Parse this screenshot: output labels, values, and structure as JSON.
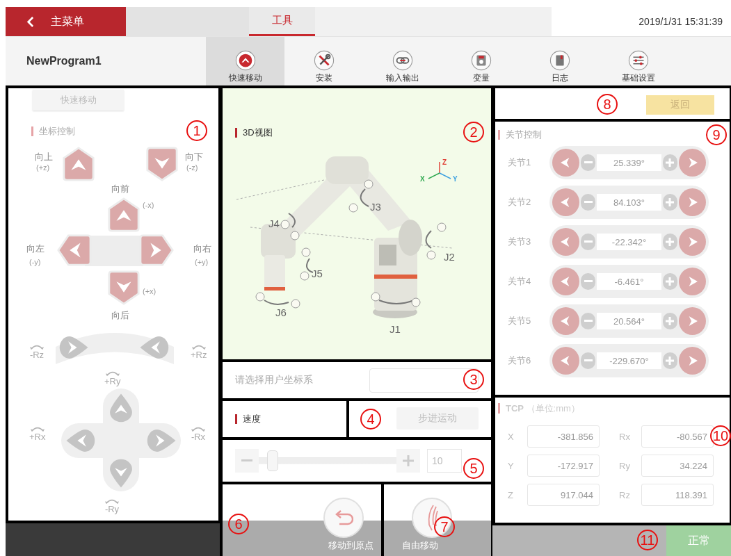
{
  "header": {
    "back_label": "主菜单",
    "tabs": [
      {
        "label": "工具",
        "selected": true
      }
    ],
    "datetime": "2019/1/31 15:31:39"
  },
  "program_name": "NewProgram1",
  "toolbar": [
    {
      "label": "快速移动",
      "kind": "jog",
      "selected": true
    },
    {
      "label": "安装",
      "kind": "tools",
      "selected": false
    },
    {
      "label": "输入输出",
      "kind": "io",
      "selected": false
    },
    {
      "label": "变量",
      "kind": "variable",
      "selected": false
    },
    {
      "label": "日志",
      "kind": "log",
      "selected": false
    },
    {
      "label": "基础设置",
      "kind": "settings",
      "selected": false
    }
  ],
  "coordinate_panel": {
    "marker": "1",
    "mode_button": "快速移动",
    "title": "坐标控制",
    "translation_pad": {
      "up_z": {
        "label": "向上",
        "axis": "(+z)"
      },
      "down_z": {
        "label": "向下",
        "axis": "(-z)"
      },
      "forward": {
        "label": "向前",
        "axis": "(-x)"
      },
      "left": {
        "label": "向左",
        "axis": "(-y)"
      },
      "right": {
        "label": "向右",
        "axis": "(+y)"
      },
      "back": {
        "label": "向后",
        "axis": "(+x)"
      }
    },
    "rotation_pad": {
      "rz_minus": "-Rz",
      "rz_plus": "+Rz",
      "ry_plus": "+Ry",
      "rx_plus": "+Rx",
      "rx_minus": "-Rx",
      "ry_minus": "-Ry"
    }
  },
  "view_3d": {
    "marker": "2",
    "title": "3D视图",
    "joint_labels": [
      "J1",
      "J2",
      "J3",
      "J4",
      "J5",
      "J6"
    ],
    "axes": [
      {
        "label": "Z",
        "color": "#e0443a"
      },
      {
        "label": "X",
        "color": "#2fa84f"
      },
      {
        "label": "Y",
        "color": "#3a9fe0"
      }
    ]
  },
  "user_frame": {
    "marker": "3",
    "label": "请选择用户坐标系"
  },
  "speed": {
    "title": "速度",
    "marker": "5",
    "level": 0.1,
    "value": "10"
  },
  "step": {
    "marker": "4",
    "button": "步进运动"
  },
  "home": {
    "marker": "6",
    "label": "移动到原点"
  },
  "free_move": {
    "marker": "7",
    "label": "自由移动"
  },
  "back_section": {
    "marker": "8",
    "button": "返回"
  },
  "joint_panel": {
    "marker": "9",
    "title": "关节控制",
    "joints": [
      {
        "label": "关节1",
        "value": "25.339°"
      },
      {
        "label": "关节2",
        "value": "84.103°"
      },
      {
        "label": "关节3",
        "value": "-22.342°"
      },
      {
        "label": "关节4",
        "value": "-6.461°"
      },
      {
        "label": "关节5",
        "value": "20.564°"
      },
      {
        "label": "关节6",
        "value": "-229.670°"
      }
    ]
  },
  "tcp_panel": {
    "marker": "10",
    "title": "**TCP** （单位:mm）",
    "fields": [
      {
        "label": "X",
        "value": "-381.856"
      },
      {
        "label": "Rx",
        "value": "-80.567"
      },
      {
        "label": "Y",
        "value": "-172.917"
      },
      {
        "label": "Ry",
        "value": "34.224"
      },
      {
        "label": "Z",
        "value": "917.044"
      },
      {
        "label": "Rz",
        "value": "118.391"
      }
    ]
  },
  "status_bar": {
    "marker": "11",
    "status": "正常"
  }
}
